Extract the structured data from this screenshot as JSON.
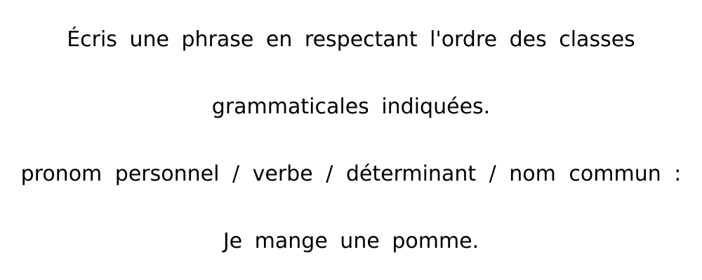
{
  "exercise": {
    "instruction_line_1": "Écris une phrase en respectant l'ordre des classes",
    "instruction_line_2": "grammaticales indiquées.",
    "pattern": "pronom personnel / verbe / déterminant / nom commun :",
    "answer": "Je mange une pomme."
  }
}
